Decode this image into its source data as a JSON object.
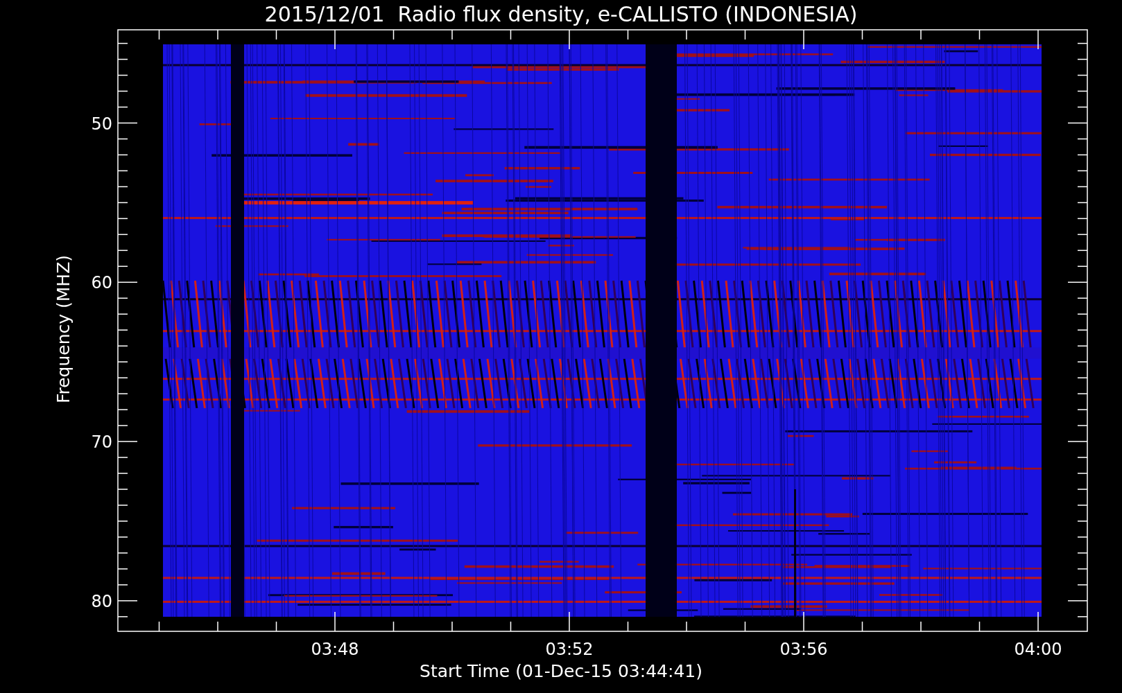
{
  "title": "2015/12/01  Radio flux density, e-CALLISTO (INDONESIA)",
  "y_axis": {
    "label": "Frequency (MHZ)",
    "ticks": [
      "50",
      "60",
      "70",
      "80"
    ]
  },
  "x_axis": {
    "label": "Start Time (01-Dec-15 03:44:41)",
    "ticks": [
      "03:48",
      "03:52",
      "03:56",
      "04:00"
    ]
  }
}
